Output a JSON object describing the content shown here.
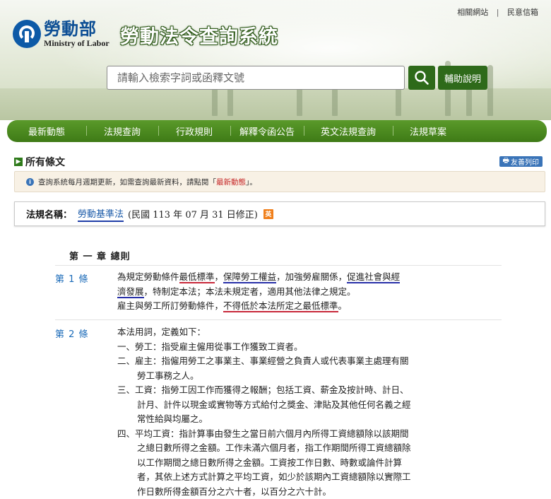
{
  "toplinks": {
    "related": "相關網站",
    "sep": "|",
    "mailbox": "民意信箱"
  },
  "header": {
    "logo_cn": "勞動部",
    "logo_en": "Ministry of Labor",
    "site_title": "勞動法令查詢系統",
    "search_placeholder": "請輸入檢索字詞或函釋文號",
    "help_label": "輔助說明"
  },
  "nav": [
    "最新動態",
    "法規查詢",
    "行政規則",
    "解釋令函公告",
    "英文法規查詢",
    "法規草案"
  ],
  "section": {
    "title": "所有條文",
    "print_label": "友善列印"
  },
  "notice": {
    "before": "查詢系統每月週期更新，如需查詢最新資料，請點閱「",
    "link": "最新動態",
    "after": "」。"
  },
  "law": {
    "label": "法規名稱：",
    "name": "勞動基準法",
    "date": "(民國 113 年 07 月 31 日修正)",
    "eng_badge": "英"
  },
  "chapter": "第 一 章  總則",
  "articles": [
    {
      "no": "第 1 條",
      "l1a": "為規定勞動條件",
      "l1b": "最低標準",
      "l1c": "，",
      "l1d": "保障勞工權益",
      "l1e": "，加強勞雇關係，",
      "l1f": "促進社會與經",
      "l2a": "濟發展",
      "l2b": "，特制定本法；本法未規定者，適用其他法律之規定。",
      "l3a": "雇主與勞工所訂勞動條件，",
      "l3b": "不得低於本法所定之最低標準",
      "l3c": "。"
    },
    {
      "no": "第 2 條",
      "intro": "本法用詞，定義如下：",
      "items": [
        "一、勞工：指受雇主僱用從事工作獲致工資者。",
        "二、雇主：指僱用勞工之事業主、事業經營之負責人或代表事業主處理有關勞工事務之人。",
        "三、工資：指勞工因工作而獲得之報酬；包括工資、薪金及按計時、計日、計月、計件以現金或實物等方式給付之獎金、津貼及其他任何名義之經常性給與均屬之。",
        "四、平均工資：指計算事由發生之當日前六個月內所得工資總額除以該期間之總日數所得之金額。工作未滿六個月者，指工作期間所得工資總額除以工作期間之總日數所得之金額。工資按工作日數、時數或論件計算者，其依上述方式計算之平均工資，如少於該期內工資總額除以實際工作日數所得金額百分之六十者，以百分之六十計。"
      ]
    }
  ],
  "colors": {
    "nav_green": "#3e7a16",
    "link_blue": "#1a6ab8",
    "underline_blue": "#2830a8",
    "underline_red": "#c8283a",
    "badge_orange": "#f07f1a"
  }
}
